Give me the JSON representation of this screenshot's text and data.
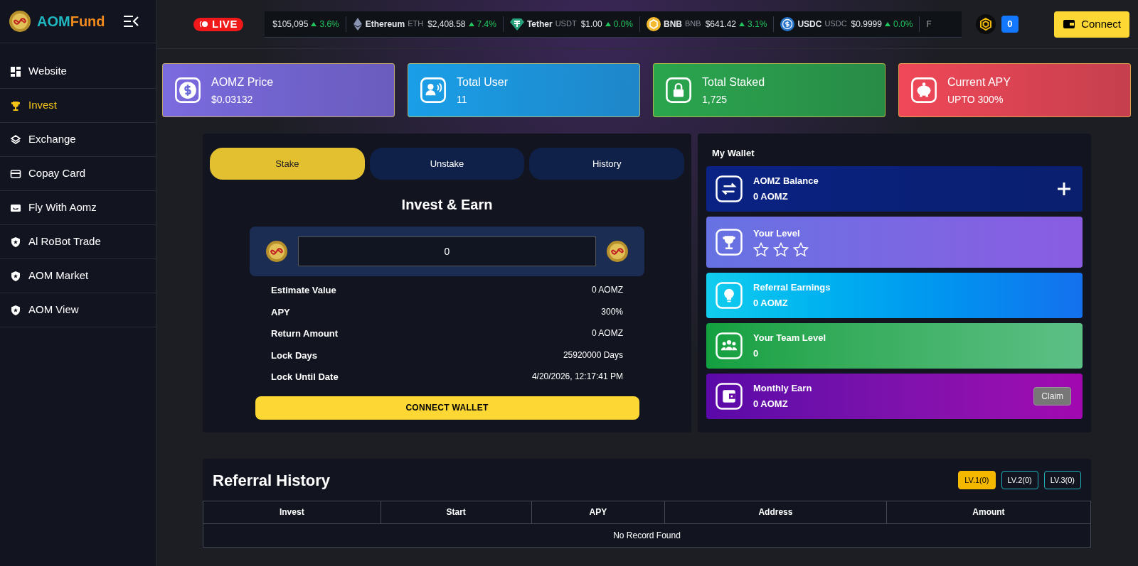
{
  "brand": {
    "part1": "AOM",
    "part2": "Fund"
  },
  "sidebar": {
    "items": [
      {
        "label": "Website",
        "selected": false
      },
      {
        "label": "Invest",
        "selected": true
      },
      {
        "label": "Exchange",
        "selected": false
      },
      {
        "label": "Copay Card",
        "selected": false
      },
      {
        "label": "Fly With Aomz",
        "selected": false
      },
      {
        "label": "Al RoBot Trade",
        "selected": false
      },
      {
        "label": "AOM Market",
        "selected": false
      },
      {
        "label": "AOM View",
        "selected": false
      }
    ]
  },
  "header": {
    "live": "LIVE",
    "ticker": [
      {
        "price": "$105,095",
        "change": "3.6%"
      },
      {
        "name": "Ethereum",
        "symbol": "ETH",
        "price": "$2,408.58",
        "change": "7.4%"
      },
      {
        "name": "Tether",
        "symbol": "USDT",
        "price": "$1.00",
        "change": "0.0%"
      },
      {
        "name": "BNB",
        "symbol": "BNB",
        "price": "$641.42",
        "change": "3.1%"
      },
      {
        "name": "USDC",
        "symbol": "USDC",
        "price": "$0.9999",
        "change": "0.0%"
      },
      {
        "name": "F"
      }
    ],
    "chain_count": "0",
    "connect": "Connect"
  },
  "stats": [
    {
      "label": "AOMZ Price",
      "value": "$0.03132",
      "color": "#7b6be0"
    },
    {
      "label": "Total User",
      "value": "11",
      "color": "#1a9fe8"
    },
    {
      "label": "Total Staked",
      "value": "1,725",
      "color": "#2aa64d"
    },
    {
      "label": "Current APY",
      "value": "UPTO 300%",
      "color": "#f04858"
    }
  ],
  "stake": {
    "tabs": [
      {
        "label": "Stake",
        "selected": true
      },
      {
        "label": "Unstake",
        "selected": false
      },
      {
        "label": "History",
        "selected": false
      }
    ],
    "title": "Invest & Earn",
    "amount": "0",
    "rows": [
      {
        "label": "Estimate Value",
        "value": "0 AOMZ"
      },
      {
        "label": "APY",
        "value": "300%"
      },
      {
        "label": "Return Amount",
        "value": "0 AOMZ"
      },
      {
        "label": "Lock Days",
        "value": "25920000 Days"
      },
      {
        "label": "Lock Until Date",
        "value": "4/20/2026, 12:17:41 PM"
      }
    ],
    "button": "CONNECT WALLET"
  },
  "wallet": {
    "title": "My Wallet",
    "cards": [
      {
        "kind": "add",
        "label": "AOMZ Balance",
        "value": "0 AOMZ"
      },
      {
        "kind": "stars",
        "label": "Your Level",
        "stars": 0
      },
      {
        "kind": "plain",
        "label": "Referral Earnings",
        "value": "0 AOMZ"
      },
      {
        "kind": "plain",
        "label": "Your Team Level",
        "value": "0"
      },
      {
        "kind": "claim",
        "label": "Monthly Earn",
        "value": "0 AOMZ",
        "button": "Claim"
      }
    ]
  },
  "referral": {
    "title": "Referral History",
    "levels": [
      {
        "label": "LV.1(0)",
        "selected": true
      },
      {
        "label": "LV.2(0)",
        "selected": false
      },
      {
        "label": "LV.3(0)",
        "selected": false
      }
    ],
    "table": {
      "columns": [
        "Invest",
        "Start",
        "APY",
        "Address",
        "Amount"
      ],
      "empty": "No Record Found"
    }
  }
}
